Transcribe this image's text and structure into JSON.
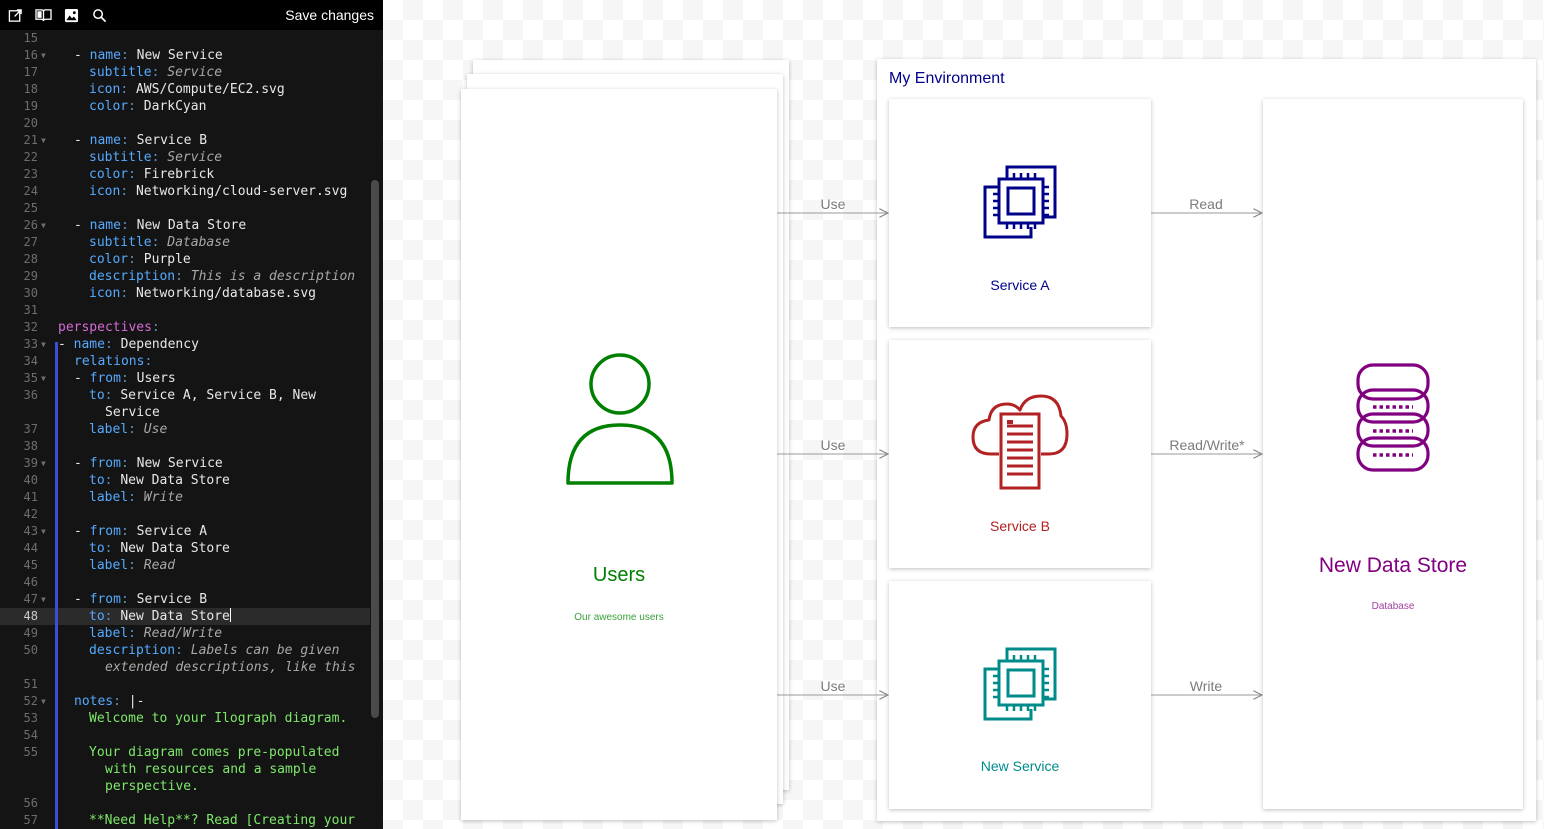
{
  "toolbar": {
    "save_label": "Save changes",
    "icons": [
      "open-external-icon",
      "book-icon",
      "image-icon",
      "search-icon"
    ]
  },
  "editor": {
    "lines": [
      {
        "n": "15",
        "segs": []
      },
      {
        "n": "16",
        "fold": true,
        "segs": [
          {
            "t": "- ",
            "c": ""
          },
          {
            "t": "name",
            "c": "k"
          },
          {
            "t": ": ",
            "c": "d"
          },
          {
            "t": "New Service",
            "c": ""
          }
        ],
        "indent": 1
      },
      {
        "n": "17",
        "segs": [
          {
            "t": "subtitle",
            "c": "k"
          },
          {
            "t": ": ",
            "c": "d"
          },
          {
            "t": "Service",
            "c": "s"
          }
        ],
        "indent": 2
      },
      {
        "n": "18",
        "segs": [
          {
            "t": "icon",
            "c": "k"
          },
          {
            "t": ": ",
            "c": "d"
          },
          {
            "t": "AWS/Compute/EC2.svg",
            "c": ""
          }
        ],
        "indent": 2
      },
      {
        "n": "19",
        "segs": [
          {
            "t": "color",
            "c": "k"
          },
          {
            "t": ": ",
            "c": "d"
          },
          {
            "t": "DarkCyan",
            "c": ""
          }
        ],
        "indent": 2
      },
      {
        "n": "20",
        "segs": []
      },
      {
        "n": "21",
        "fold": true,
        "segs": [
          {
            "t": "- ",
            "c": ""
          },
          {
            "t": "name",
            "c": "k"
          },
          {
            "t": ": ",
            "c": "d"
          },
          {
            "t": "Service B",
            "c": ""
          }
        ],
        "indent": 1
      },
      {
        "n": "22",
        "segs": [
          {
            "t": "subtitle",
            "c": "k"
          },
          {
            "t": ": ",
            "c": "d"
          },
          {
            "t": "Service",
            "c": "s"
          }
        ],
        "indent": 2
      },
      {
        "n": "23",
        "segs": [
          {
            "t": "color",
            "c": "k"
          },
          {
            "t": ": ",
            "c": "d"
          },
          {
            "t": "Firebrick",
            "c": ""
          }
        ],
        "indent": 2
      },
      {
        "n": "24",
        "segs": [
          {
            "t": "icon",
            "c": "k"
          },
          {
            "t": ": ",
            "c": "d"
          },
          {
            "t": "Networking/cloud-server.svg",
            "c": ""
          }
        ],
        "indent": 2
      },
      {
        "n": "25",
        "segs": []
      },
      {
        "n": "26",
        "fold": true,
        "segs": [
          {
            "t": "- ",
            "c": ""
          },
          {
            "t": "name",
            "c": "k"
          },
          {
            "t": ": ",
            "c": "d"
          },
          {
            "t": "New Data Store",
            "c": ""
          }
        ],
        "indent": 1
      },
      {
        "n": "27",
        "segs": [
          {
            "t": "subtitle",
            "c": "k"
          },
          {
            "t": ": ",
            "c": "d"
          },
          {
            "t": "Database",
            "c": "s"
          }
        ],
        "indent": 2
      },
      {
        "n": "28",
        "segs": [
          {
            "t": "color",
            "c": "k"
          },
          {
            "t": ": ",
            "c": "d"
          },
          {
            "t": "Purple",
            "c": ""
          }
        ],
        "indent": 2
      },
      {
        "n": "29",
        "segs": [
          {
            "t": "description",
            "c": "k"
          },
          {
            "t": ": ",
            "c": "d"
          },
          {
            "t": "This is a description",
            "c": "s"
          }
        ],
        "indent": 2
      },
      {
        "n": "30",
        "segs": [
          {
            "t": "icon",
            "c": "k"
          },
          {
            "t": ": ",
            "c": "d"
          },
          {
            "t": "Networking/database.svg",
            "c": ""
          }
        ],
        "indent": 2
      },
      {
        "n": "31",
        "segs": []
      },
      {
        "n": "32",
        "segs": [
          {
            "t": "perspectives",
            "c": "p"
          },
          {
            "t": ":",
            "c": "d"
          }
        ],
        "indent": 0
      },
      {
        "n": "33",
        "fold": true,
        "segs": [
          {
            "t": "- ",
            "c": ""
          },
          {
            "t": "name",
            "c": "k"
          },
          {
            "t": ": ",
            "c": "d"
          },
          {
            "t": "Dependency",
            "c": ""
          }
        ],
        "indent": 0
      },
      {
        "n": "34",
        "segs": [
          {
            "t": "relations",
            "c": "k"
          },
          {
            "t": ":",
            "c": "d"
          }
        ],
        "indent": 1
      },
      {
        "n": "35",
        "fold": true,
        "segs": [
          {
            "t": "- ",
            "c": ""
          },
          {
            "t": "from",
            "c": "k"
          },
          {
            "t": ": ",
            "c": "d"
          },
          {
            "t": "Users",
            "c": ""
          }
        ],
        "indent": 1
      },
      {
        "n": "36",
        "segs": [
          {
            "t": "to",
            "c": "k"
          },
          {
            "t": ": ",
            "c": "d"
          },
          {
            "t": "Service A, Service B, New",
            "c": ""
          }
        ],
        "indent": 2
      },
      {
        "n": "",
        "segs": [
          {
            "t": "Service",
            "c": ""
          }
        ],
        "indent": 2,
        "extra": 2
      },
      {
        "n": "37",
        "segs": [
          {
            "t": "label",
            "c": "k"
          },
          {
            "t": ": ",
            "c": "d"
          },
          {
            "t": "Use",
            "c": "s"
          }
        ],
        "indent": 2
      },
      {
        "n": "38",
        "segs": []
      },
      {
        "n": "39",
        "fold": true,
        "segs": [
          {
            "t": "- ",
            "c": ""
          },
          {
            "t": "from",
            "c": "k"
          },
          {
            "t": ": ",
            "c": "d"
          },
          {
            "t": "New Service",
            "c": ""
          }
        ],
        "indent": 1
      },
      {
        "n": "40",
        "segs": [
          {
            "t": "to",
            "c": "k"
          },
          {
            "t": ": ",
            "c": "d"
          },
          {
            "t": "New Data Store",
            "c": ""
          }
        ],
        "indent": 2
      },
      {
        "n": "41",
        "segs": [
          {
            "t": "label",
            "c": "k"
          },
          {
            "t": ": ",
            "c": "d"
          },
          {
            "t": "Write",
            "c": "s"
          }
        ],
        "indent": 2
      },
      {
        "n": "42",
        "segs": []
      },
      {
        "n": "43",
        "fold": true,
        "segs": [
          {
            "t": "- ",
            "c": ""
          },
          {
            "t": "from",
            "c": "k"
          },
          {
            "t": ": ",
            "c": "d"
          },
          {
            "t": "Service A",
            "c": ""
          }
        ],
        "indent": 1
      },
      {
        "n": "44",
        "segs": [
          {
            "t": "to",
            "c": "k"
          },
          {
            "t": ": ",
            "c": "d"
          },
          {
            "t": "New Data Store",
            "c": ""
          }
        ],
        "indent": 2
      },
      {
        "n": "45",
        "segs": [
          {
            "t": "label",
            "c": "k"
          },
          {
            "t": ": ",
            "c": "d"
          },
          {
            "t": "Read",
            "c": "s"
          }
        ],
        "indent": 2
      },
      {
        "n": "46",
        "segs": []
      },
      {
        "n": "47",
        "fold": true,
        "segs": [
          {
            "t": "- ",
            "c": ""
          },
          {
            "t": "from",
            "c": "k"
          },
          {
            "t": ": ",
            "c": "d"
          },
          {
            "t": "Service B",
            "c": ""
          }
        ],
        "indent": 1
      },
      {
        "n": "48",
        "cur": true,
        "segs": [
          {
            "t": "to",
            "c": "k"
          },
          {
            "t": ": ",
            "c": "d"
          },
          {
            "t": "New Data Store",
            "c": ""
          }
        ],
        "indent": 2
      },
      {
        "n": "49",
        "segs": [
          {
            "t": "label",
            "c": "k"
          },
          {
            "t": ": ",
            "c": "d"
          },
          {
            "t": "Read/Write",
            "c": "s"
          }
        ],
        "indent": 2
      },
      {
        "n": "50",
        "segs": [
          {
            "t": "description",
            "c": "k"
          },
          {
            "t": ": ",
            "c": "d"
          },
          {
            "t": "Labels can be given",
            "c": "s"
          }
        ],
        "indent": 2
      },
      {
        "n": "",
        "segs": [
          {
            "t": "extended descriptions, like this",
            "c": "s"
          }
        ],
        "indent": 2,
        "extra": 2
      },
      {
        "n": "51",
        "segs": []
      },
      {
        "n": "52",
        "fold": true,
        "segs": [
          {
            "t": "notes",
            "c": "k"
          },
          {
            "t": ": ",
            "c": "d"
          },
          {
            "t": "|-",
            "c": ""
          }
        ],
        "indent": 1
      },
      {
        "n": "53",
        "segs": [
          {
            "t": "Welcome to your Ilograph diagram.",
            "c": "g"
          }
        ],
        "indent": 2
      },
      {
        "n": "54",
        "segs": []
      },
      {
        "n": "55",
        "segs": [
          {
            "t": "Your diagram comes pre-populated",
            "c": "g"
          }
        ],
        "indent": 2
      },
      {
        "n": "",
        "segs": [
          {
            "t": "with resources and a sample",
            "c": "g"
          }
        ],
        "indent": 2,
        "extra": 2
      },
      {
        "n": "",
        "segs": [
          {
            "t": "perspective.",
            "c": "g"
          }
        ],
        "indent": 2,
        "extra": 2
      },
      {
        "n": "56",
        "segs": []
      },
      {
        "n": "57",
        "segs": [
          {
            "t": "**Need Help**? Read [Creating your",
            "c": "g"
          }
        ],
        "indent": 2
      }
    ]
  },
  "diagram": {
    "users": {
      "title": "Users",
      "subtitle": "Our awesome users",
      "color": "#008000"
    },
    "environment": {
      "title": "My Environment",
      "color": "#00008B"
    },
    "service_a": {
      "title": "Service A",
      "color": "#00008B"
    },
    "service_b": {
      "title": "Service B",
      "color": "#B22222"
    },
    "new_service": {
      "title": "New Service",
      "color": "#008B8B"
    },
    "data_store": {
      "title": "New Data Store",
      "subtitle": "Database",
      "color": "#800080"
    },
    "relations": {
      "use1": "Use",
      "use2": "Use",
      "use3": "Use",
      "read": "Read",
      "readwrite": "Read/Write*",
      "write": "Write"
    }
  }
}
